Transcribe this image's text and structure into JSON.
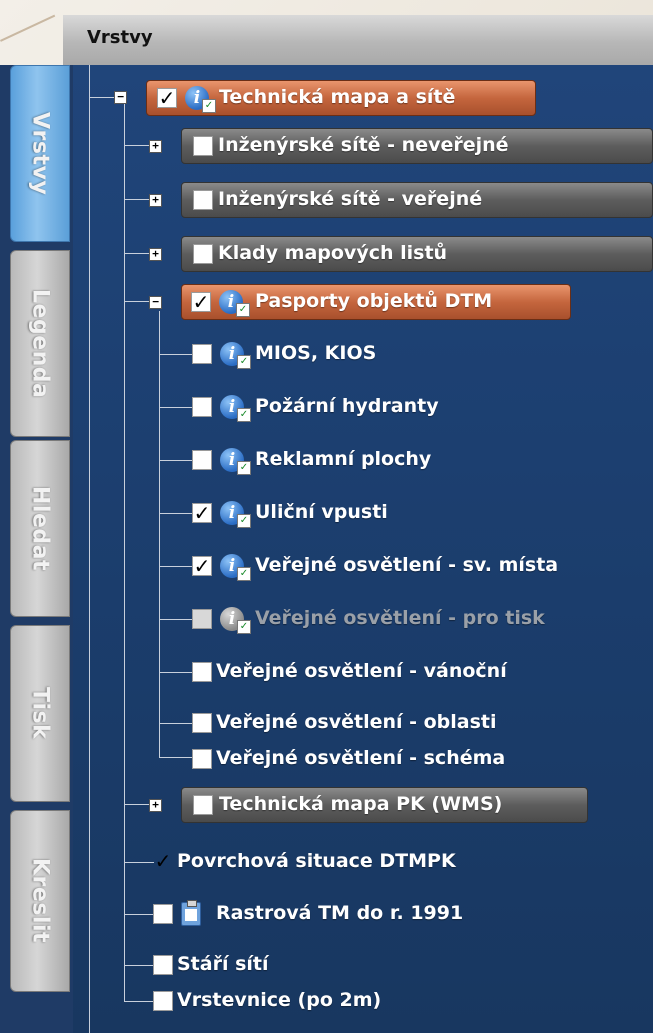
{
  "panel": {
    "title": "Vrstvy"
  },
  "tabs": [
    "Vrstvy",
    "Legenda",
    "Hledat",
    "Tisk",
    "Kreslit"
  ],
  "layers": [
    {
      "label": "Technická mapa a sítě",
      "checked": true,
      "expander": "−",
      "icons": [
        "info-icon"
      ]
    },
    {
      "label": "Inženýrské sítě - neveřejné",
      "checked": false,
      "expander": "+"
    },
    {
      "label": "Inženýrské sítě - veřejné",
      "checked": false,
      "expander": "+"
    },
    {
      "label": "Klady mapových listů",
      "checked": false,
      "expander": "+"
    },
    {
      "label": "Pasporty objektů DTM",
      "checked": true,
      "expander": "−",
      "icons": [
        "info-icon"
      ]
    },
    {
      "label": "MIOS, KIOS",
      "checked": false,
      "icons": [
        "info-icon"
      ]
    },
    {
      "label": "Požární hydranty",
      "checked": false,
      "icons": [
        "info-icon"
      ]
    },
    {
      "label": "Reklamní plochy",
      "checked": false,
      "icons": [
        "info-icon"
      ]
    },
    {
      "label": "Uliční vpusti",
      "checked": true,
      "icons": [
        "info-icon"
      ]
    },
    {
      "label": "Veřejné osvětlení - sv. místa",
      "checked": true,
      "icons": [
        "info-icon"
      ]
    },
    {
      "label": "Veřejné osvětlení - pro tisk",
      "checked": false,
      "disabled": true,
      "icons": [
        "info-icon"
      ]
    },
    {
      "label": "Veřejné osvětlení - vánoční",
      "checked": false
    },
    {
      "label": "Veřejné osvětlení - oblasti",
      "checked": false
    },
    {
      "label": "Veřejné osvětlení - schéma",
      "checked": false
    },
    {
      "label": "Technická mapa PK (WMS)",
      "checked": false,
      "expander": "+"
    },
    {
      "label": "Povrchová situace DTMPK",
      "checked": true
    },
    {
      "label": "Rastrová TM do r. 1991",
      "checked": false,
      "icons": [
        "clipboard-icon"
      ]
    },
    {
      "label": "Stáří sítí",
      "checked": false
    },
    {
      "label": "Vrstevnice (po 2m)",
      "checked": false
    }
  ],
  "glyphs": {
    "check": "✓",
    "info": "i",
    "ok": "✓"
  },
  "colors": {
    "panel": "#1f3b66",
    "active_tab": "#6aaee6",
    "group_bar_orange": "#c5663e",
    "group_bar_gray": "#5d5d5d"
  }
}
